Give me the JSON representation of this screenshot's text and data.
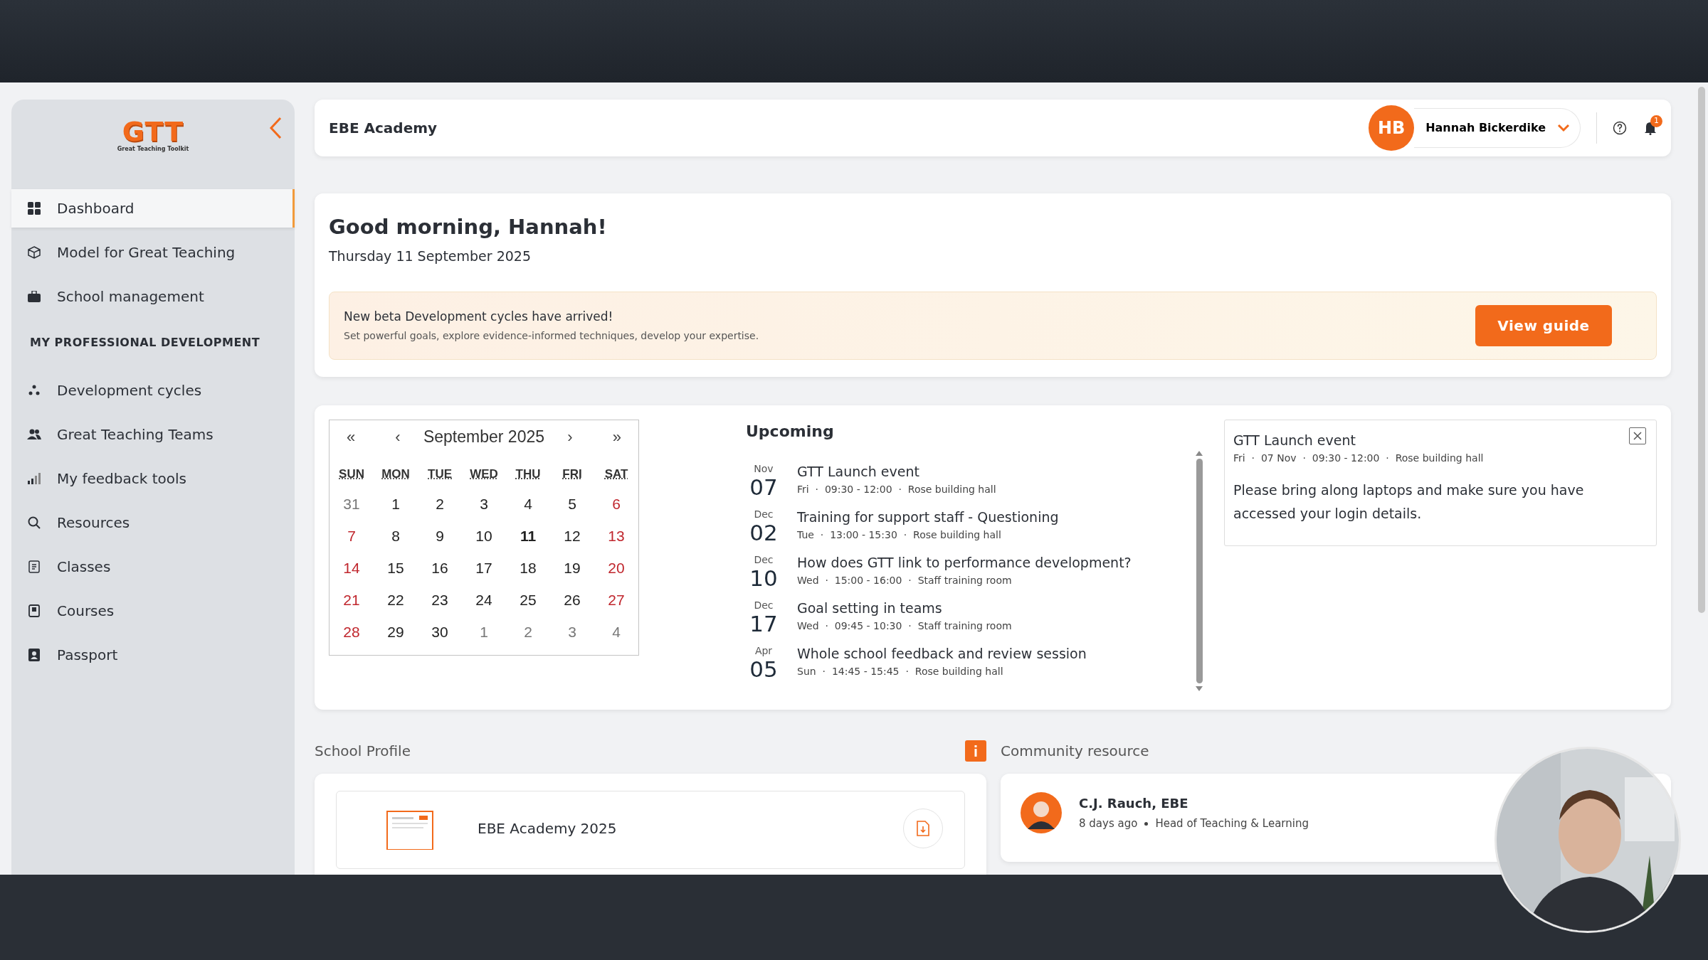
{
  "sidebar": {
    "logo": "GTT",
    "logo_tagline": "Great Teaching Toolkit",
    "items": [
      {
        "label": "Dashboard",
        "selected": true
      },
      {
        "label": "Model for Great Teaching",
        "selected": false
      },
      {
        "label": "School management",
        "selected": false
      }
    ],
    "section_title": "MY PROFESSIONAL DEVELOPMENT",
    "section_items": [
      {
        "label": "Development cycles",
        "selected": false
      },
      {
        "label": "Great Teaching Teams",
        "selected": false
      },
      {
        "label": "My feedback tools",
        "selected": false
      },
      {
        "label": "Resources",
        "selected": false
      },
      {
        "label": "Classes",
        "selected": false
      },
      {
        "label": "Courses",
        "selected": false
      },
      {
        "label": "Passport",
        "selected": false
      }
    ]
  },
  "header": {
    "school": "EBE Academy",
    "user_initials": "HB",
    "user_name": "Hannah Bickerdike",
    "notification_count": "1"
  },
  "greeting": {
    "title": "Good morning, Hannah!",
    "date": "Thursday 11 September 2025",
    "banner": {
      "title": "New beta Development cycles have arrived!",
      "text": "Set powerful goals, explore evidence-informed techniques, develop your expertise.",
      "button": "View guide"
    }
  },
  "calendar": {
    "first": "«",
    "prev": "‹",
    "month": "September 2025",
    "next": "›",
    "last": "»",
    "weekdays": [
      "SUN",
      "MON",
      "TUE",
      "WED",
      "THU",
      "FRI",
      "SAT"
    ],
    "weeks": [
      [
        {
          "d": "31",
          "kind": "other"
        },
        {
          "d": "1",
          "kind": "day"
        },
        {
          "d": "2",
          "kind": "day"
        },
        {
          "d": "3",
          "kind": "day"
        },
        {
          "d": "4",
          "kind": "day"
        },
        {
          "d": "5",
          "kind": "day"
        },
        {
          "d": "6",
          "kind": "weekend"
        }
      ],
      [
        {
          "d": "7",
          "kind": "weekend"
        },
        {
          "d": "8",
          "kind": "day"
        },
        {
          "d": "9",
          "kind": "day"
        },
        {
          "d": "10",
          "kind": "day"
        },
        {
          "d": "11",
          "kind": "today"
        },
        {
          "d": "12",
          "kind": "day"
        },
        {
          "d": "13",
          "kind": "weekend"
        }
      ],
      [
        {
          "d": "14",
          "kind": "weekend"
        },
        {
          "d": "15",
          "kind": "day"
        },
        {
          "d": "16",
          "kind": "day"
        },
        {
          "d": "17",
          "kind": "day"
        },
        {
          "d": "18",
          "kind": "day"
        },
        {
          "d": "19",
          "kind": "day"
        },
        {
          "d": "20",
          "kind": "weekend"
        }
      ],
      [
        {
          "d": "21",
          "kind": "weekend"
        },
        {
          "d": "22",
          "kind": "day"
        },
        {
          "d": "23",
          "kind": "day"
        },
        {
          "d": "24",
          "kind": "day"
        },
        {
          "d": "25",
          "kind": "day"
        },
        {
          "d": "26",
          "kind": "day"
        },
        {
          "d": "27",
          "kind": "weekend"
        }
      ],
      [
        {
          "d": "28",
          "kind": "weekend"
        },
        {
          "d": "29",
          "kind": "day"
        },
        {
          "d": "30",
          "kind": "day"
        },
        {
          "d": "1",
          "kind": "other"
        },
        {
          "d": "2",
          "kind": "other"
        },
        {
          "d": "3",
          "kind": "other"
        },
        {
          "d": "4",
          "kind": "other"
        }
      ]
    ]
  },
  "upcoming": {
    "title": "Upcoming",
    "events": [
      {
        "month": "Nov",
        "day": "07",
        "title": "GTT Launch event",
        "meta": "Fri  ·  09:30 - 12:00  ·  Rose building hall"
      },
      {
        "month": "Dec",
        "day": "02",
        "title": "Training for support staff - Questioning",
        "meta": "Tue  ·  13:00 - 15:30  ·  Rose building hall"
      },
      {
        "month": "Dec",
        "day": "10",
        "title": "How does GTT link to performance development?",
        "meta": "Wed  ·  15:00 - 16:00  ·  Staff training room"
      },
      {
        "month": "Dec",
        "day": "17",
        "title": "Goal setting in teams",
        "meta": "Wed  ·  09:45 - 10:30  ·  Staff training room"
      },
      {
        "month": "Apr",
        "day": "05",
        "title": "Whole school feedback and review session",
        "meta": "Sun  ·  14:45 - 15:45  ·  Rose building hall"
      }
    ]
  },
  "event_detail": {
    "title": "GTT Launch event",
    "meta": "Fri  ·  07 Nov  ·  09:30 - 12:00  ·  Rose building hall",
    "text": "Please bring along laptops and make sure you have accessed your login details."
  },
  "school_profile": {
    "label": "School Profile",
    "document": "EBE Academy 2025"
  },
  "community": {
    "label": "Community resource",
    "author": "C.J. Rauch, EBE",
    "age": "8 days ago",
    "role": "Head of Teaching & Learning"
  }
}
